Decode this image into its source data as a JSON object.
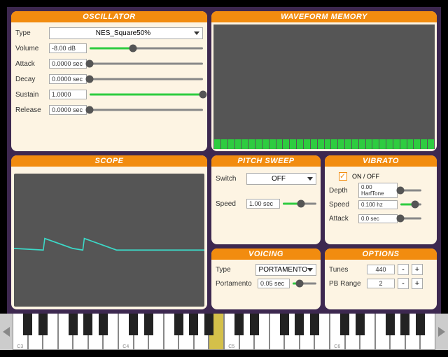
{
  "oscillator": {
    "title": "OSCILLATOR",
    "type_label": "Type",
    "type_value": "NES_Square50%",
    "volume_label": "Volume",
    "volume_value": "-8.00 dB",
    "volume_pct": 38,
    "attack_label": "Attack",
    "attack_value": "0.0000 sec",
    "attack_pct": 0,
    "decay_label": "Decay",
    "decay_value": "0.0000 sec",
    "decay_pct": 0,
    "sustain_label": "Sustain",
    "sustain_value": "1.0000",
    "sustain_pct": 100,
    "release_label": "Release",
    "release_value": "0.0000 sec",
    "release_pct": 0
  },
  "scope": {
    "title": "SCOPE"
  },
  "waveform_memory": {
    "title": "WAVEFORM MEMORY"
  },
  "pitch_sweep": {
    "title": "PITCH SWEEP",
    "switch_label": "Switch",
    "switch_value": "OFF",
    "speed_label": "Speed",
    "speed_value": "1.00 sec",
    "speed_pct": 55
  },
  "vibrato": {
    "title": "VIBRATO",
    "onoff_label": "ON / OFF",
    "onoff_checked": true,
    "depth_label": "Depth",
    "depth_value": "0.00 HarfTone",
    "depth_pct": 0,
    "speed_label": "Speed",
    "speed_value": "0.100 hz",
    "speed_pct": 70,
    "attack_label": "Attack",
    "attack_value": "0.0 sec",
    "attack_pct": 0
  },
  "voicing": {
    "title": "VOICING",
    "type_label": "Type",
    "type_value": "PORTAMENTO",
    "portamento_label": "Portamento",
    "portamento_value": "0.05 sec",
    "portamento_pct": 30
  },
  "options": {
    "title": "OPTIONS",
    "tunes_label": "Tunes",
    "tunes_value": "440",
    "pbrange_label": "PB Range",
    "pbrange_value": "2"
  },
  "keyboard": {
    "octave_labels": [
      "C3",
      "C4",
      "C5",
      "C6"
    ],
    "active_note": "B4"
  }
}
